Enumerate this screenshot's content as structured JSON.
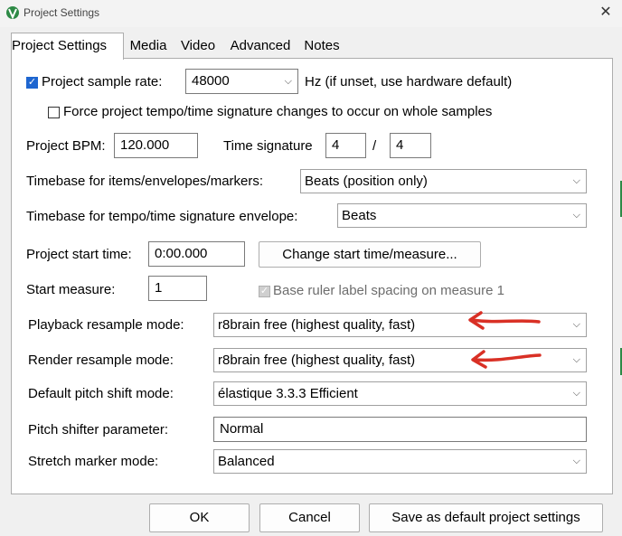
{
  "window": {
    "title": "Project Settings",
    "close_glyph": "✕"
  },
  "tabs": [
    {
      "label": "Project Settings",
      "active": true
    },
    {
      "label": "Media"
    },
    {
      "label": "Video"
    },
    {
      "label": "Advanced"
    },
    {
      "label": "Notes"
    }
  ],
  "sample_rate": {
    "label": "Project sample rate:",
    "checked": true,
    "value": "48000",
    "suffix": "Hz (if unset, use hardware default)"
  },
  "force_tempo": {
    "label": "Force project tempo/time signature changes to occur on whole samples",
    "checked": false
  },
  "bpm": {
    "label": "Project BPM:",
    "value": "120.000"
  },
  "time_signature": {
    "label": "Time signature",
    "numerator": "4",
    "slash": "/",
    "denominator": "4"
  },
  "timebase_items": {
    "label": "Timebase for items/envelopes/markers:",
    "value": "Beats (position only)"
  },
  "timebase_tempo": {
    "label": "Timebase for tempo/time signature envelope:",
    "value": "Beats"
  },
  "start_time": {
    "label": "Project start time:",
    "value": "0:00.000",
    "change_button": "Change start time/measure..."
  },
  "start_measure": {
    "label": "Start measure:",
    "value": "1"
  },
  "base_ruler": {
    "label": "Base ruler label spacing on measure 1",
    "checked": true,
    "disabled": true
  },
  "playback_resample": {
    "label": "Playback resample mode:",
    "value": "r8brain free (highest quality, fast)"
  },
  "render_resample": {
    "label": "Render resample mode:",
    "value": "r8brain free (highest quality, fast)"
  },
  "pitch_shift": {
    "label": "Default pitch shift mode:",
    "value": "élastique 3.3.3 Efficient"
  },
  "pitch_param": {
    "label": "Pitch shifter parameter:",
    "value": "Normal"
  },
  "stretch_marker": {
    "label": "Stretch marker mode:",
    "value": "Balanced"
  },
  "buttons": {
    "ok": "OK",
    "cancel": "Cancel",
    "save_default": "Save as default project settings"
  },
  "colors": {
    "annotation_arrow": "#d93025",
    "checkbox_accent": "#1e66d0",
    "chevron": "⌵"
  }
}
